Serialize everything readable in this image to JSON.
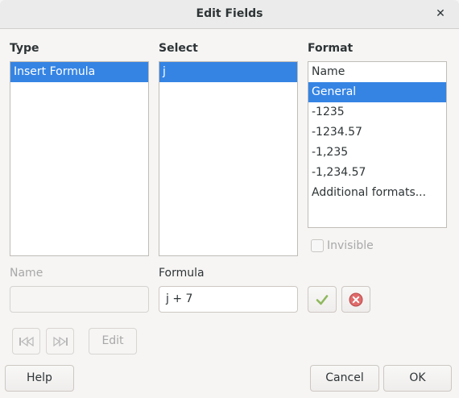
{
  "window": {
    "title": "Edit Fields",
    "close_icon": "close-icon"
  },
  "type_column": {
    "label": "Type",
    "items": [
      "Insert Formula"
    ],
    "selected": 0
  },
  "select_column": {
    "label": "Select",
    "items": [
      "j"
    ],
    "selected": 0
  },
  "format_column": {
    "label": "Format",
    "items": [
      "Name",
      "General",
      "-1235",
      "-1234.57",
      "-1,235",
      "-1,234.57",
      "Additional formats..."
    ],
    "selected": 1
  },
  "invisible_checkbox": {
    "label": "Invisible",
    "checked": false,
    "enabled": false
  },
  "name_field": {
    "label": "Name",
    "value": "",
    "enabled": false
  },
  "formula_field": {
    "label": "Formula",
    "value": "j + 7"
  },
  "apply_icon": "checkmark-icon",
  "cancel_formula_icon": "cancel-icon",
  "nav": {
    "first_icon": "skip-first-icon",
    "last_icon": "skip-last-icon",
    "edit_label": "Edit"
  },
  "buttons": {
    "help": "Help",
    "cancel": "Cancel",
    "ok": "OK"
  },
  "colors": {
    "selection": "#3584e4",
    "check_green": "#8fb85d",
    "cancel_red": "#e06b6b"
  }
}
